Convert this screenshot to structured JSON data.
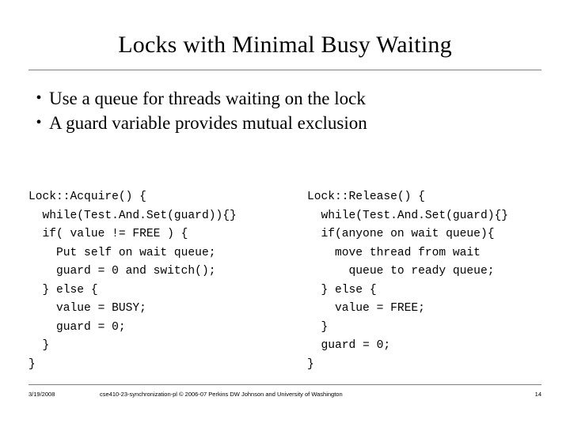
{
  "slide": {
    "title": "Locks with Minimal Busy Waiting",
    "bullet_marker": "•",
    "bullets": [
      "Use a queue for threads waiting on the lock",
      "A guard variable provides mutual exclusion"
    ],
    "code_left": "Lock::Acquire() {\n  while(Test.And.Set(guard)){}\n  if( value != FREE ) {\n    Put self on wait queue;\n    guard = 0 and switch();\n  } else {\n    value = BUSY;\n    guard = 0;\n  }\n}",
    "code_right": "Lock::Release() {\n  while(Test.And.Set(guard){}\n  if(anyone on wait queue){\n    move thread from wait\n      queue to ready queue;\n  } else {\n    value = FREE;\n  }\n  guard = 0;\n}",
    "footer": {
      "date": "3/19/2008",
      "center": "cse410-23-synchronization-pl  © 2006-07 Perkins DW Johnson and University of Washington",
      "page": "14"
    }
  }
}
